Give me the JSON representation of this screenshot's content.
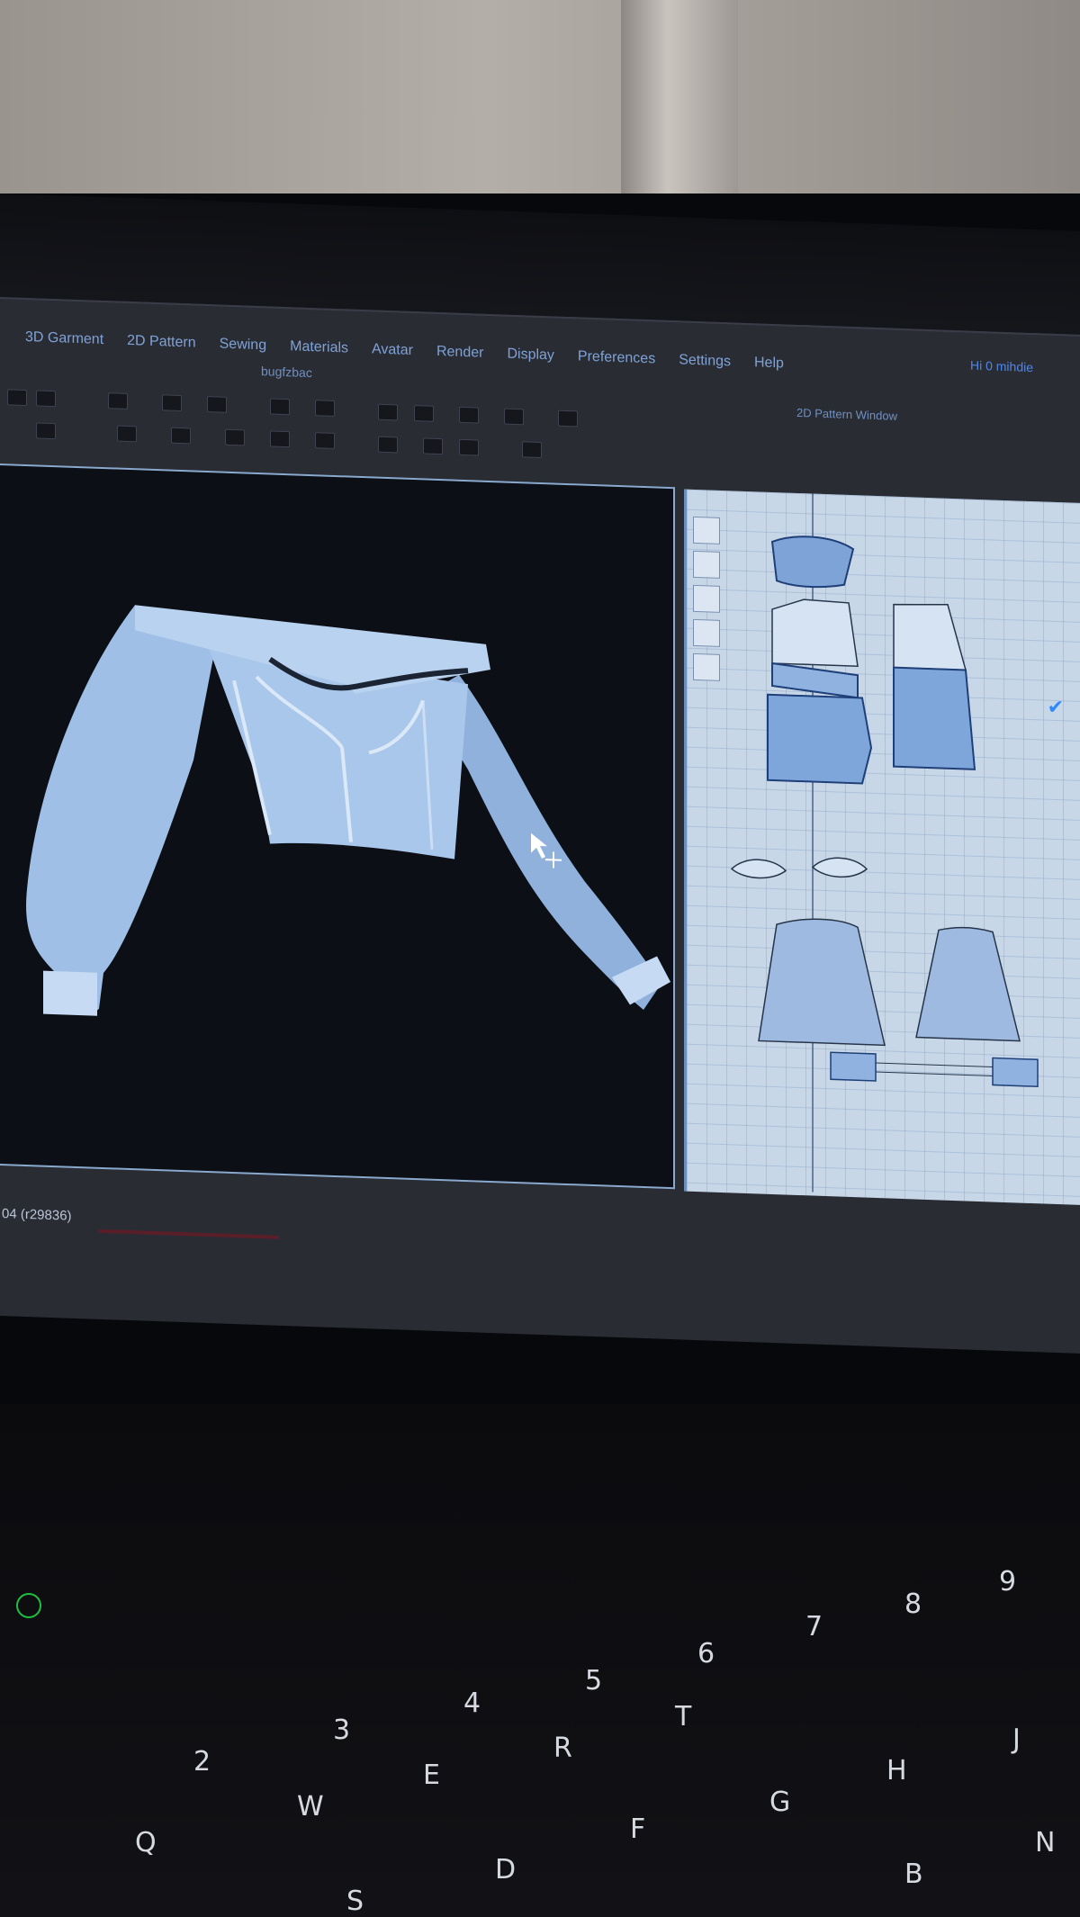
{
  "app": {
    "menu": [
      "3D Garment",
      "2D Pattern",
      "Sewing",
      "Materials",
      "Avatar",
      "Render",
      "Display",
      "Preferences",
      "Settings",
      "Help"
    ],
    "subtitle": "bugfzbac",
    "user": "Hi 0 mihdie",
    "pattern_panel_title": "2D Pattern Window",
    "status": "04 (r29836)"
  },
  "keyboard": {
    "keys": [
      "Q",
      "W",
      "E",
      "R",
      "T",
      "2",
      "3",
      "4",
      "5",
      "6",
      "7",
      "8",
      "9",
      "D",
      "G",
      "H",
      "J",
      "N",
      "B",
      "F",
      "S"
    ]
  },
  "colors": {
    "garment": "#9fbfe6",
    "viewport_bg": "#0c0f16",
    "pattern_bg": "#c8d7e8",
    "accent": "#2e88ff"
  }
}
